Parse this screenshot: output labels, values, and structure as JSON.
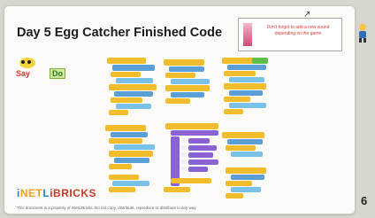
{
  "slide": {
    "title": "Day 5 Egg Catcher Finished Code",
    "note_text": "Don't forget to add a new sound depending on the game",
    "sprite_say": "Say",
    "sprite_do": "Do",
    "logo_parts": [
      "i",
      "NET",
      "L",
      "iBRICKS"
    ],
    "footer": "This document is a property of iNetLiBricks. Do not copy, distribute, reproduce or distribute in any way.",
    "page_number": "6"
  },
  "colors": {
    "background": "#fbfaf7",
    "control_block": "#f2bd2c",
    "motion_block": "#5c9fd6",
    "sensing_block": "#79c1e8",
    "looks_block": "#8b62d3",
    "operator_block": "#5fbf4c"
  }
}
